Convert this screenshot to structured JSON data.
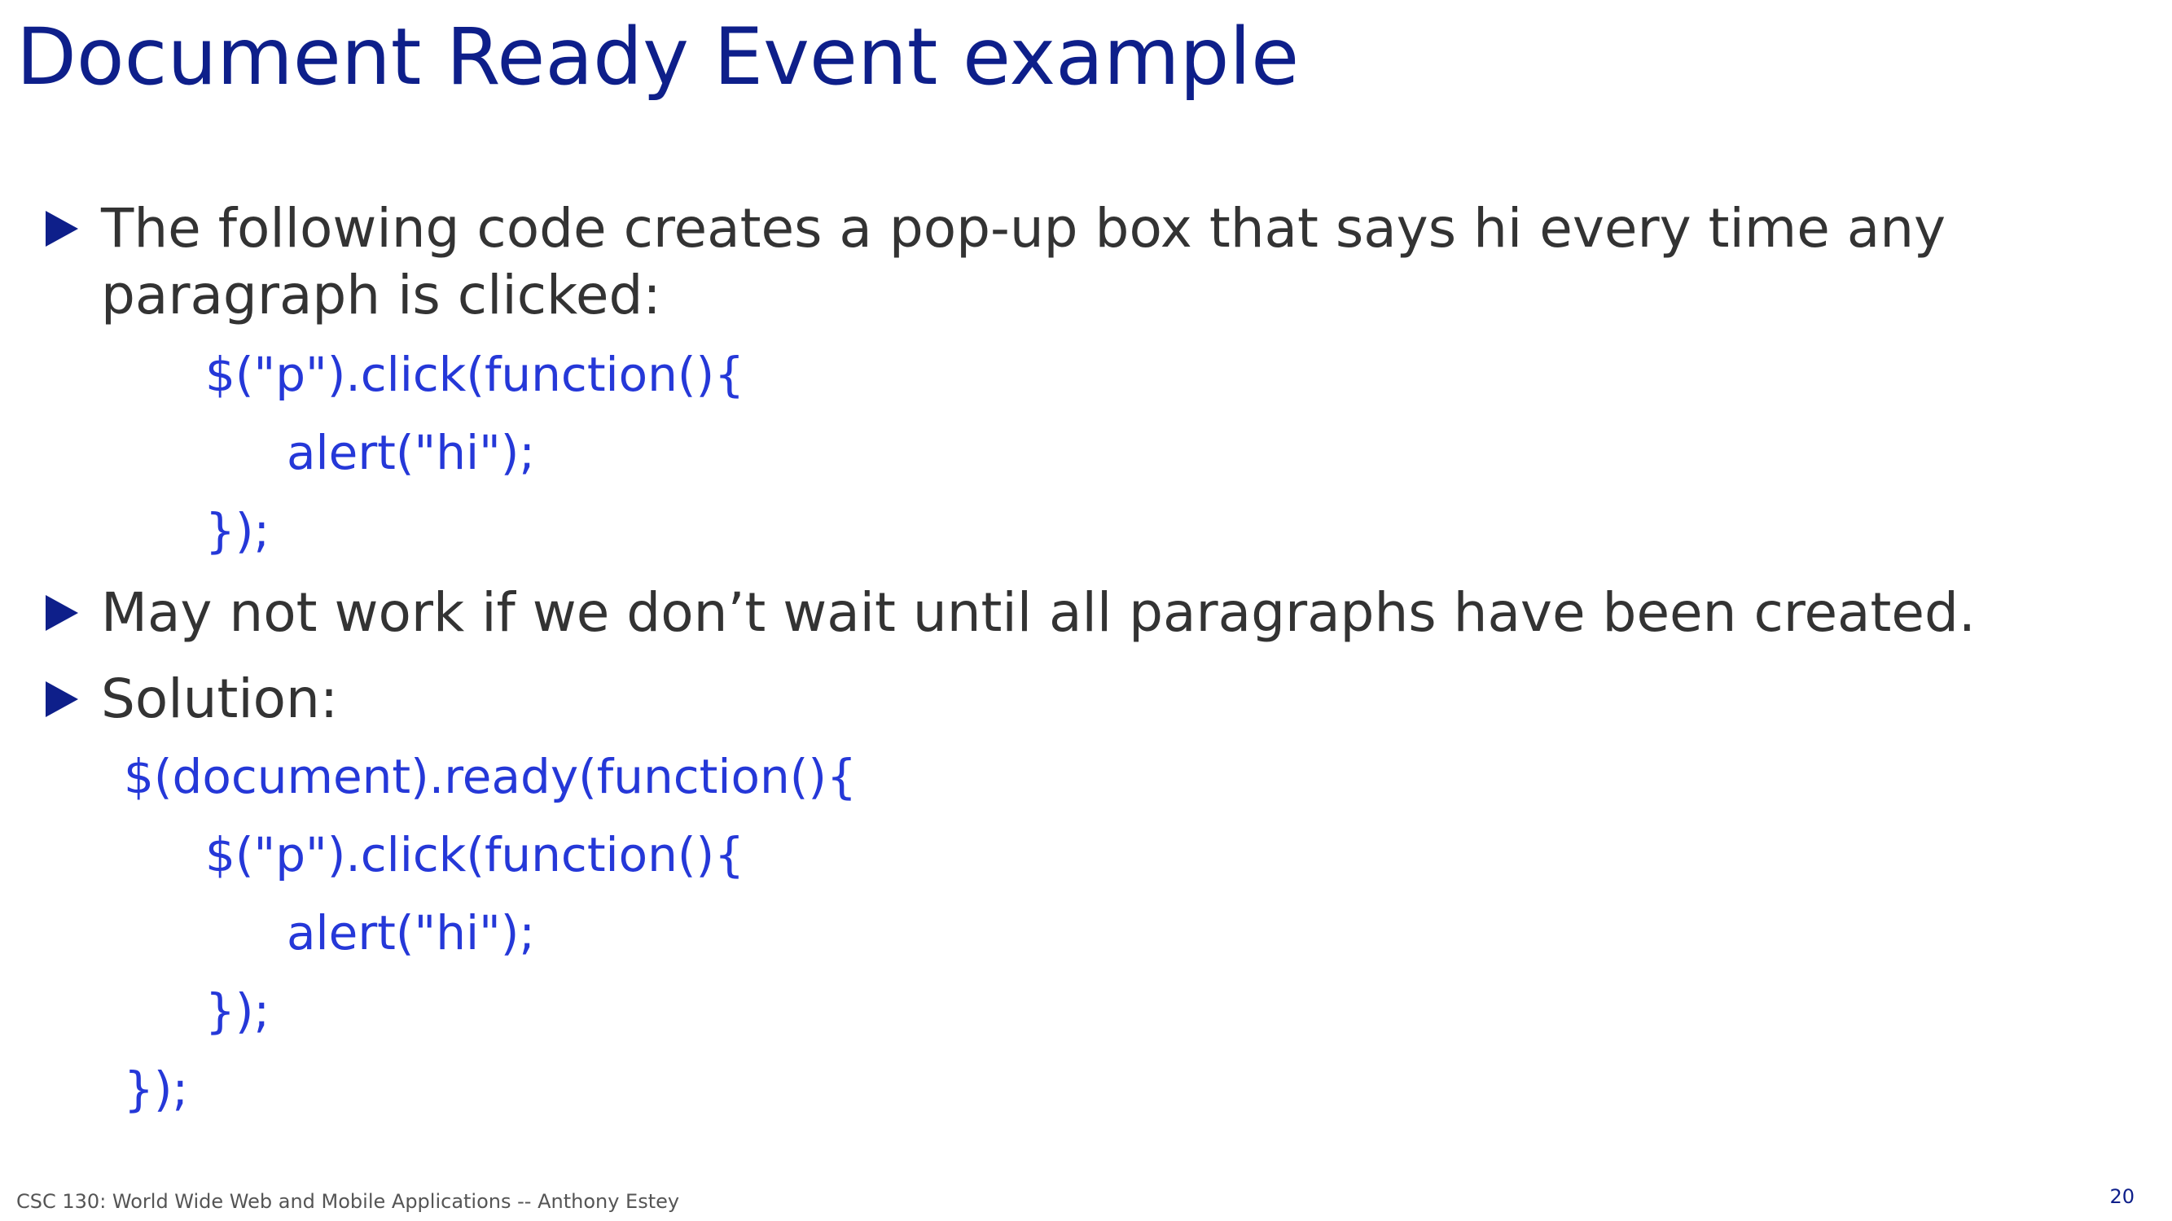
{
  "slide": {
    "title": "Document Ready Event example",
    "bullets": [
      {
        "line1": "The following code creates a pop-up box that says hi every time any",
        "line2": "paragraph is clicked:"
      },
      {
        "line1": "May not work if we don’t wait until all paragraphs have been created."
      },
      {
        "line1": "Solution:"
      }
    ],
    "code_example_1": [
      "$(\"p\").click(function(){",
      "alert(\"hi\");",
      "});"
    ],
    "code_example_2": [
      "$(document).ready(function(){",
      "$(\"p\").click(function(){",
      "alert(\"hi\");",
      "});",
      "});"
    ]
  },
  "footer": {
    "course": "CSC 130: World Wide Web and Mobile Applications -- Anthony Estey",
    "page_number": "20"
  },
  "colors": {
    "title": "#0e1f8a",
    "bullet_marker": "#0e1f8a",
    "body_text": "#333333",
    "code_text": "#2538d8"
  },
  "icons": {
    "bullet": "triangle-right-icon"
  }
}
